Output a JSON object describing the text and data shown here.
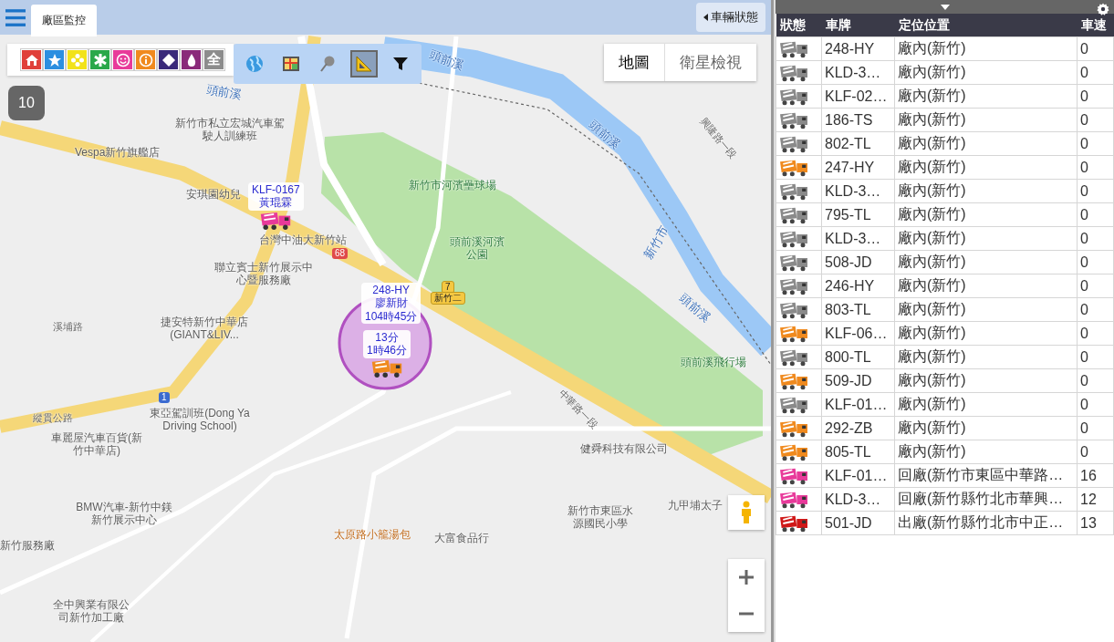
{
  "top_bar": {
    "tab": "廠區監控",
    "status_button": "車輛狀態"
  },
  "categories": [
    {
      "kind": "home",
      "color": "#e0403a"
    },
    {
      "kind": "star",
      "color": "#2c8fe0"
    },
    {
      "kind": "flower",
      "color": "#f2e21a"
    },
    {
      "kind": "asterisk",
      "color": "#2aa84a"
    },
    {
      "kind": "smile",
      "color": "#e83a9a"
    },
    {
      "kind": "info",
      "color": "#f08a1e"
    },
    {
      "kind": "diamond",
      "color": "#3a2a7a"
    },
    {
      "kind": "drop",
      "color": "#8a2a7a"
    },
    {
      "kind": "all",
      "color": "#8c8c8c",
      "label": "全"
    }
  ],
  "tools": [
    {
      "kind": "globe",
      "selected": false
    },
    {
      "kind": "map",
      "selected": false
    },
    {
      "kind": "pin",
      "selected": false
    },
    {
      "kind": "ruler",
      "selected": true
    },
    {
      "kind": "filter",
      "selected": false
    }
  ],
  "vehicle_count": "10",
  "map_types": [
    {
      "label": "地圖",
      "selected": true
    },
    {
      "label": "衛星檢視",
      "selected": false
    }
  ],
  "map_labels": [
    {
      "kind": "water",
      "text": "頭前溪"
    },
    {
      "kind": "water",
      "text": "頭前溪"
    },
    {
      "kind": "place",
      "text": "新竹市私立宏城汽車駕駛人訓練班"
    },
    {
      "kind": "place",
      "text": "Vespa新竹旗艦店"
    },
    {
      "kind": "place",
      "text": "安琪園幼兒"
    },
    {
      "kind": "place",
      "text": "台灣中油大新竹站"
    },
    {
      "kind": "park",
      "text": "新竹市河濱壘球場"
    },
    {
      "kind": "park",
      "text": "頭前溪河濱公園"
    },
    {
      "kind": "water",
      "text": "頭前溪"
    },
    {
      "kind": "road",
      "text": "興隆路一段"
    },
    {
      "kind": "water",
      "text": "新竹市"
    },
    {
      "kind": "water",
      "text": "頭前溪"
    },
    {
      "kind": "place",
      "text": "聯立賓士新竹展示中心暨服務廠"
    },
    {
      "kind": "road",
      "text": "溪埔路"
    },
    {
      "kind": "place",
      "text": "捷安特新竹中華店(GIANT&LIV..."
    },
    {
      "kind": "road",
      "text": "縱貫公路"
    },
    {
      "kind": "place",
      "text": "東亞駕訓班(Dong Ya Driving School)"
    },
    {
      "kind": "place",
      "text": "車麗屋汽車百貨(新竹中華店)"
    },
    {
      "kind": "place",
      "text": "BMW汽車-新竹中鎂新竹展示中心"
    },
    {
      "kind": "place",
      "text": "新竹服務廠"
    },
    {
      "kind": "park",
      "text": "頭前溪飛行場"
    },
    {
      "kind": "place",
      "text": "健舜科技有限公司"
    },
    {
      "kind": "place",
      "text": "新竹市東區水源國民小學"
    },
    {
      "kind": "place",
      "text": "九甲埔太子"
    },
    {
      "kind": "food",
      "text": "太原路小籠湯包"
    },
    {
      "kind": "place",
      "text": "大富食品行"
    },
    {
      "kind": "place",
      "text": "全中興業有限公司新竹加工廠"
    },
    {
      "kind": "road",
      "text": "中華路一段"
    },
    {
      "kind": "shield-red",
      "text": "68"
    },
    {
      "kind": "shield-blue",
      "text": "1"
    },
    {
      "kind": "shield-yellow",
      "text": "7"
    },
    {
      "kind": "shield-yellow",
      "text": "新竹二"
    }
  ],
  "markers": [
    {
      "color": "#e83a9a",
      "lines": [
        "KLF-0167",
        "黃琨霖"
      ]
    },
    {
      "lines": [
        "248-HY",
        "廖新財",
        "104時45分"
      ]
    },
    {
      "color": "#f08a1e",
      "lines": [
        "13分",
        "1時46分"
      ]
    }
  ],
  "vehicles": {
    "columns": [
      "狀態",
      "車牌",
      "定位位置",
      "車速"
    ],
    "rows": [
      {
        "color": "#8a8a8a",
        "plate": "248-HY",
        "location": "廠內(新竹)",
        "speed": "0"
      },
      {
        "color": "#8a8a8a",
        "plate": "KLD-3…",
        "location": "廠內(新竹)",
        "speed": "0"
      },
      {
        "color": "#8a8a8a",
        "plate": "KLF-02…",
        "location": "廠內(新竹)",
        "speed": "0"
      },
      {
        "color": "#8a8a8a",
        "plate": "186-TS",
        "location": "廠內(新竹)",
        "speed": "0"
      },
      {
        "color": "#8a8a8a",
        "plate": "802-TL",
        "location": "廠內(新竹)",
        "speed": "0"
      },
      {
        "color": "#f08a1e",
        "plate": "247-HY",
        "location": "廠內(新竹)",
        "speed": "0"
      },
      {
        "color": "#8a8a8a",
        "plate": "KLD-3…",
        "location": "廠內(新竹)",
        "speed": "0"
      },
      {
        "color": "#8a8a8a",
        "plate": "795-TL",
        "location": "廠內(新竹)",
        "speed": "0"
      },
      {
        "color": "#8a8a8a",
        "plate": "KLD-3…",
        "location": "廠內(新竹)",
        "speed": "0"
      },
      {
        "color": "#8a8a8a",
        "plate": "508-JD",
        "location": "廠內(新竹)",
        "speed": "0"
      },
      {
        "color": "#8a8a8a",
        "plate": "246-HY",
        "location": "廠內(新竹)",
        "speed": "0"
      },
      {
        "color": "#8a8a8a",
        "plate": "803-TL",
        "location": "廠內(新竹)",
        "speed": "0"
      },
      {
        "color": "#f08a1e",
        "plate": "KLF-06…",
        "location": "廠內(新竹)",
        "speed": "0"
      },
      {
        "color": "#8a8a8a",
        "plate": "800-TL",
        "location": "廠內(新竹)",
        "speed": "0"
      },
      {
        "color": "#f08a1e",
        "plate": "509-JD",
        "location": "廠內(新竹)",
        "speed": "0"
      },
      {
        "color": "#8a8a8a",
        "plate": "KLF-01…",
        "location": "廠內(新竹)",
        "speed": "0"
      },
      {
        "color": "#f08a1e",
        "plate": "292-ZB",
        "location": "廠內(新竹)",
        "speed": "0"
      },
      {
        "color": "#f08a1e",
        "plate": "805-TL",
        "location": "廠內(新竹)",
        "speed": "0"
      },
      {
        "color": "#e83a9a",
        "plate": "KLF-01…",
        "location": "回廠(新竹市東區中華路…",
        "speed": "16"
      },
      {
        "color": "#e83a9a",
        "plate": "KLD-3…",
        "location": "回廠(新竹縣竹北市華興…",
        "speed": "12"
      },
      {
        "color": "#d01818",
        "plate": "501-JD",
        "location": "出廠(新竹縣竹北市中正…",
        "speed": "13"
      }
    ]
  }
}
